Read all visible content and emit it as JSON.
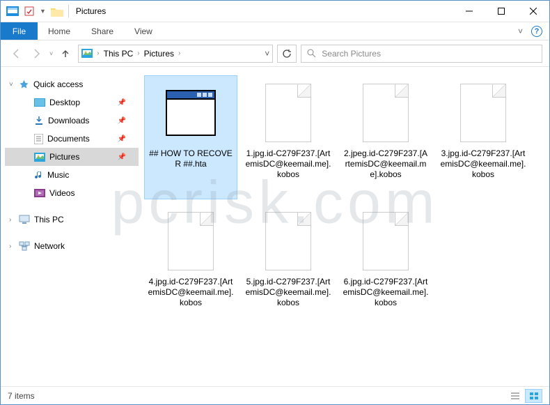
{
  "titlebar": {
    "title": "Pictures"
  },
  "ribbon": {
    "file": "File",
    "tabs": [
      "Home",
      "Share",
      "View"
    ]
  },
  "nav": {
    "path": [
      "This PC",
      "Pictures"
    ],
    "search_placeholder": "Search Pictures"
  },
  "sidebar": {
    "quick_access": "Quick access",
    "items": [
      "Desktop",
      "Downloads",
      "Documents",
      "Pictures",
      "Music",
      "Videos"
    ],
    "this_pc": "This PC",
    "network": "Network"
  },
  "files": {
    "items": [
      {
        "name": "## HOW TO RECOVER ##.hta",
        "type": "hta"
      },
      {
        "name": "1.jpg.id-C279F237.[ArtemisDC@keemail.me].kobos",
        "type": "blank"
      },
      {
        "name": "2.jpeg.id-C279F237.[ArtemisDC@keemail.me].kobos",
        "type": "blank"
      },
      {
        "name": "3.jpg.id-C279F237.[ArtemisDC@keemail.me].kobos",
        "type": "blank"
      },
      {
        "name": "4.jpg.id-C279F237.[ArtemisDC@keemail.me].kobos",
        "type": "blank"
      },
      {
        "name": "5.jpg.id-C279F237.[ArtemisDC@keemail.me].kobos",
        "type": "blank"
      },
      {
        "name": "6.jpg.id-C279F237.[ArtemisDC@keemail.me].kobos",
        "type": "blank"
      }
    ]
  },
  "statusbar": {
    "count": "7 items"
  },
  "watermark": "pcrisk.com"
}
